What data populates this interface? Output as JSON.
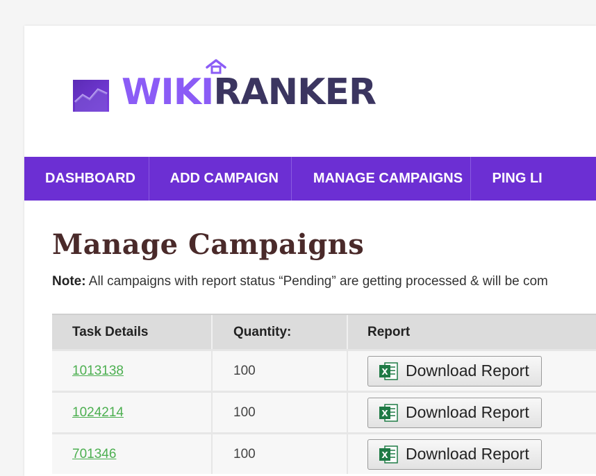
{
  "brand": {
    "wiki": "WIKI",
    "ranker": "RANKER",
    "accent": "#8b5cf6",
    "dark": "#3b3560"
  },
  "nav": {
    "items": [
      {
        "label": "DASHBOARD"
      },
      {
        "label": "ADD CAMPAIGN"
      },
      {
        "label": "MANAGE CAMPAIGNS"
      },
      {
        "label": "PING LI"
      }
    ],
    "background": "#6c2fd3"
  },
  "main": {
    "title": "Manage Campaigns",
    "note_label": "Note:",
    "note_text": " All campaigns with report status “Pending” are getting processed & will be com"
  },
  "table": {
    "headers": [
      "Task Details",
      "Quantity:",
      "Report"
    ],
    "rows": [
      {
        "task": "1013138",
        "quantity": "100",
        "report": "Download Report"
      },
      {
        "task": "1024214",
        "quantity": "100",
        "report": "Download Report"
      },
      {
        "task": "701346",
        "quantity": "100",
        "report": "Download Report"
      }
    ]
  },
  "icons": {
    "logo": "chart-area-icon",
    "report": "excel-icon"
  }
}
